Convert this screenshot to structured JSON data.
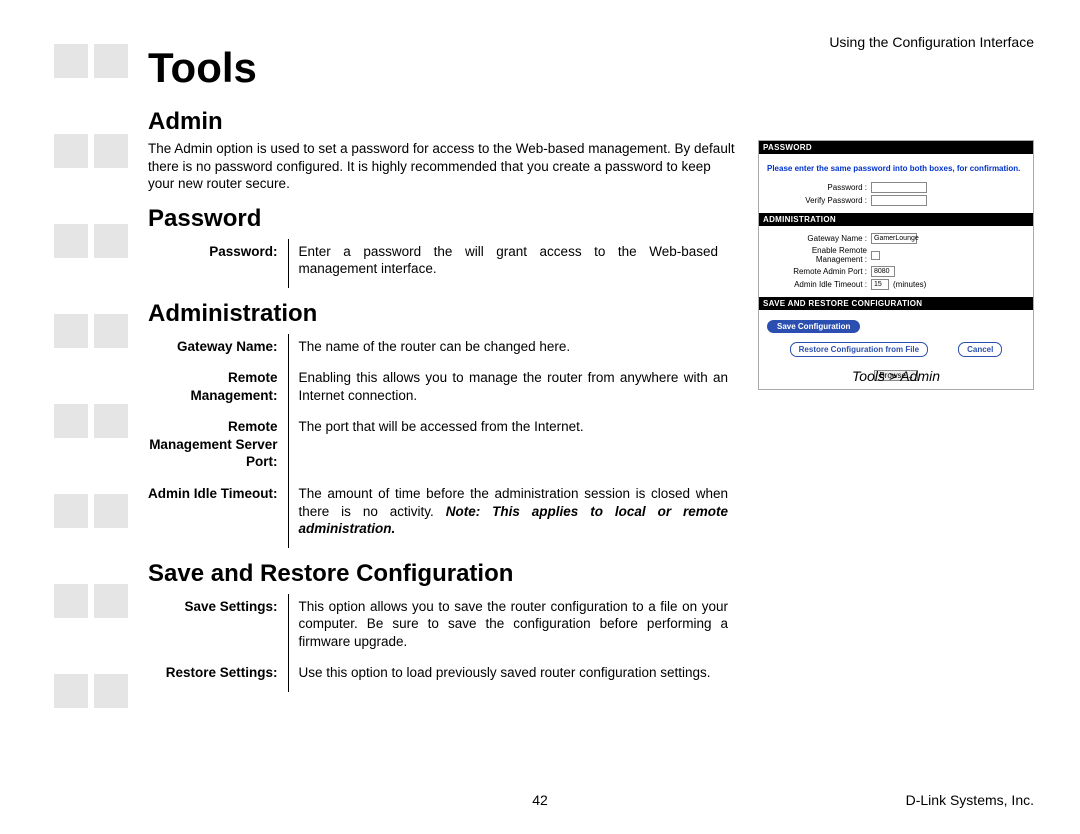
{
  "header": {
    "right": "Using the Configuration Interface"
  },
  "title": "Tools",
  "sections": {
    "admin": {
      "heading": "Admin",
      "intro": "The Admin option is used to set a password for access to the Web-based management. By default there is no password configured. It is highly recommended that you create a password to keep your new router secure."
    },
    "password": {
      "heading": "Password",
      "rows": [
        {
          "label": "Password:",
          "value": "Enter a password the will grant access to the Web-based management interface."
        }
      ]
    },
    "administration": {
      "heading": "Administration",
      "rows": [
        {
          "label": "Gateway Name:",
          "value": "The name of the router can be changed here."
        },
        {
          "label": "Remote Management:",
          "value": "Enabling this allows you to manage the router from anywhere with an Internet connection."
        },
        {
          "label": "Remote Management Server Port:",
          "value": "The port that will be accessed from the Internet."
        },
        {
          "label": "Admin Idle Timeout:",
          "value": "The amount of time before the administration session is closed when there is no activity. ",
          "note": "Note: This applies to local or remote administration."
        }
      ]
    },
    "save_restore": {
      "heading": "Save and Restore Configuration",
      "rows": [
        {
          "label": "Save Settings:",
          "value": "This option allows you to save the router configuration to a file on your computer. Be sure to save the configuration before performing a firmware upgrade."
        },
        {
          "label": "Restore Settings:",
          "value": "Use this option to load previously saved router configuration settings."
        }
      ]
    }
  },
  "screenshot": {
    "bars": {
      "password": "PASSWORD",
      "administration": "ADMINISTRATION",
      "save_restore": "SAVE AND RESTORE CONFIGURATION"
    },
    "note": "Please enter the same password into both boxes, for confirmation.",
    "labels": {
      "password": "Password :",
      "verify_password": "Verify Password :",
      "gateway_name": "Gateway Name :",
      "enable_remote": "Enable Remote Management :",
      "remote_port": "Remote Admin Port :",
      "idle_timeout": "Admin Idle Timeout :",
      "minutes": "(minutes)"
    },
    "values": {
      "gateway_name": "GamerLounge",
      "remote_port": "8080",
      "idle_timeout": "15"
    },
    "buttons": {
      "save_config": "Save Configuration",
      "restore_config": "Restore Configuration from File",
      "cancel": "Cancel",
      "browse": "Browse..."
    }
  },
  "caption": "Tools > Admin",
  "footer": {
    "page": "42",
    "right": "D-Link Systems, Inc."
  }
}
